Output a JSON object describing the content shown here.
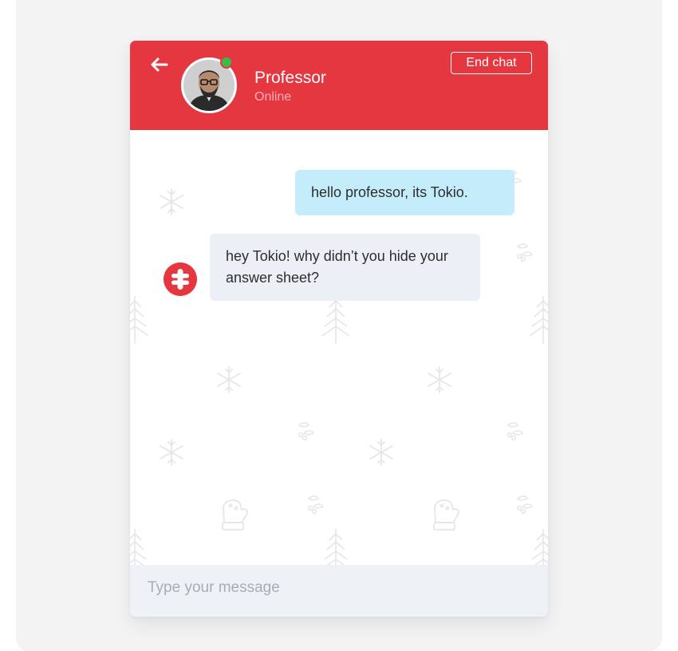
{
  "header": {
    "contact_name": "Professor",
    "status": "Online",
    "end_chat_label": "End chat"
  },
  "messages": [
    {
      "direction": "outgoing",
      "text": "hello professor, its Tokio."
    },
    {
      "direction": "incoming",
      "text": "hey Tokio! why didn’t you hide your answer sheet?"
    }
  ],
  "composer": {
    "placeholder": "Type your message",
    "value": ""
  },
  "icons": {
    "back": "arrow-left-icon",
    "bot_avatar": "bot-logo-icon",
    "pattern": [
      "snowflake-icon",
      "mitten-icon",
      "christmas-tree-icon",
      "holly-icon"
    ]
  },
  "colors": {
    "brand": "#e4373f",
    "online": "#35bd48",
    "outgoing_bubble": "#c5ecfb",
    "incoming_bubble": "#eceff5",
    "composer_bg": "#eef1f5"
  }
}
